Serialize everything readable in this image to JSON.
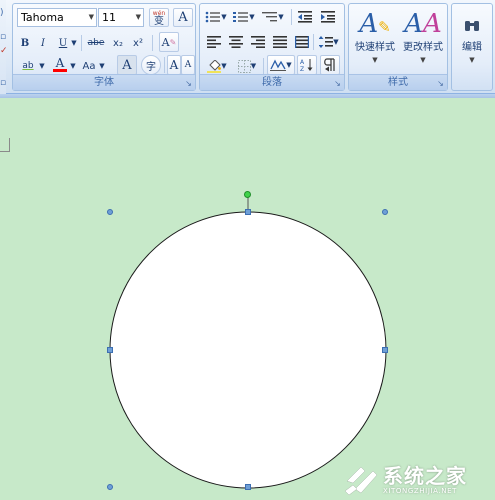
{
  "font_group": {
    "label": "字体",
    "font_name": "Tahoma",
    "font_size": "11",
    "phonetic_button": "wén",
    "phonetic_button_char": "变",
    "char_border_button": "A",
    "bold": "B",
    "italic": "I",
    "underline": "U",
    "strikethrough": "abe",
    "subscript": "x₂",
    "superscript": "x²",
    "clear_format": "A",
    "text_effect": "ab",
    "font_color": "A",
    "change_case": "Aa",
    "char_shading": "A",
    "enclose_char": "字",
    "grow_font": "A",
    "shrink_font": "A"
  },
  "paragraph_group": {
    "label": "段落"
  },
  "styles_group": {
    "label": "样式",
    "quick_styles_label": "快速样式",
    "change_styles_label": "更改样式"
  },
  "editing_group": {
    "label": "编辑"
  },
  "watermark": {
    "title": "系统之家",
    "subtitle": "XITONGZHIJIA.NET"
  },
  "colors": {
    "ribbon_text": "#15428b",
    "canvas": "#c7e9c9",
    "font_color_bar": "#ff0000",
    "handle": "#6e9fd6",
    "rotate_handle": "#3fd24a"
  }
}
